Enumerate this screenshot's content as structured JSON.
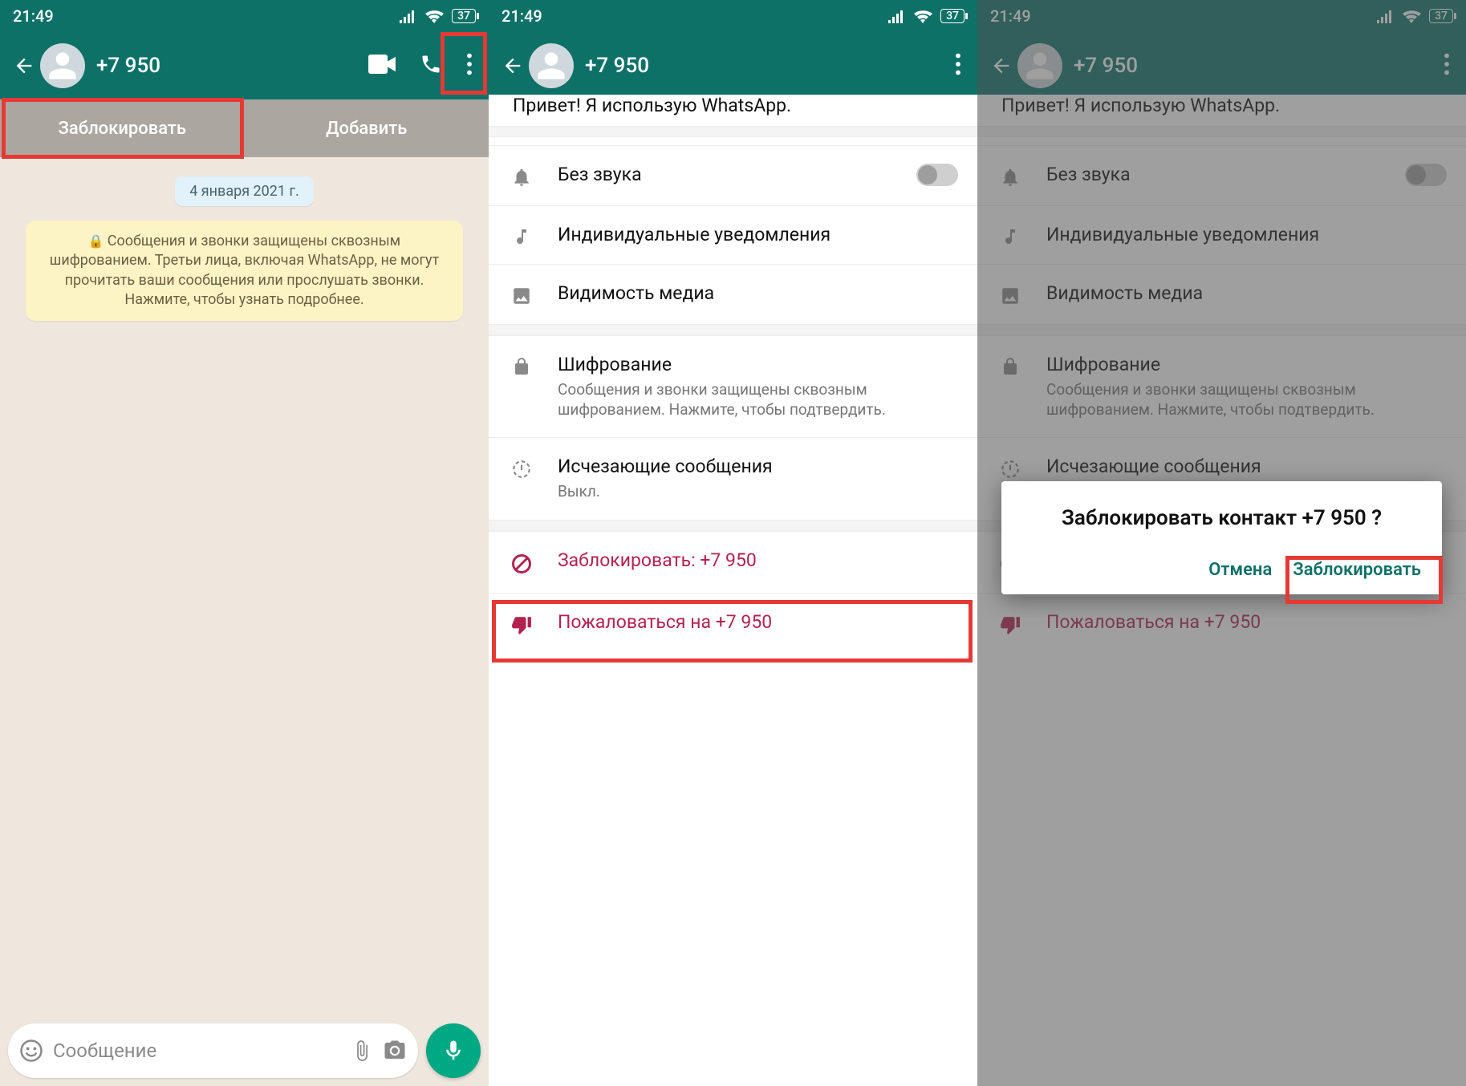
{
  "status": {
    "time": "21:49",
    "battery": "37"
  },
  "contact": {
    "phone": "+7 950"
  },
  "panel1": {
    "block": "Заблокировать",
    "add": "Добавить",
    "date": "4 января 2021 г.",
    "encryption_notice": "Сообщения и звонки защищены сквозным шифрованием. Третьи лица, включая WhatsApp, не могут прочитать ваши сообщения или прослушать звонки. Нажмите, чтобы узнать подробнее.",
    "input_placeholder": "Сообщение"
  },
  "info": {
    "partial_header": "Привет! Я использую WhatsApp.",
    "mute": "Без звука",
    "custom_notif": "Индивидуальные уведомления",
    "media_visibility": "Видимость медиа",
    "encryption": {
      "label": "Шифрование",
      "sub": "Сообщения и звонки защищены сквозным шифрованием. Нажмите, чтобы подтвердить."
    },
    "disappearing": {
      "label": "Исчезающие сообщения",
      "sub": "Выкл."
    },
    "block": "Заблокировать: +7 950",
    "report": "Пожаловаться на +7 950"
  },
  "dialog": {
    "title": "Заблокировать контакт +7 950 ?",
    "cancel": "Отмена",
    "confirm": "Заблокировать"
  }
}
